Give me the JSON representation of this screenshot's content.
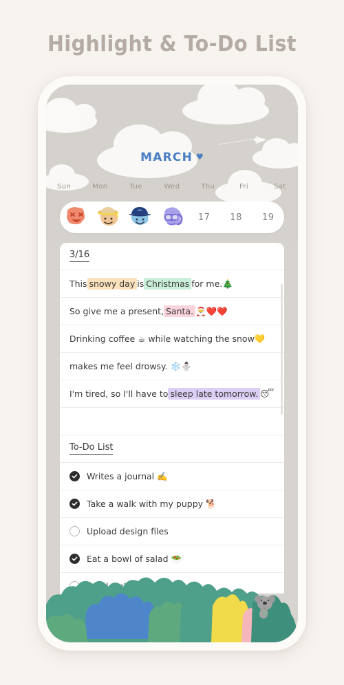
{
  "page": {
    "title": "Highlight & To-Do List",
    "background_color": "#F7F3EF",
    "title_color": "#B4ACA4"
  },
  "calendar": {
    "month_label": "MARCH",
    "month_heart": "♥",
    "month_color": "#4B7FC4",
    "days_of_week": [
      "Sun",
      "Mon",
      "Tue",
      "Wed",
      "Thu",
      "Fri",
      "Sat"
    ],
    "cells": [
      {
        "type": "sticker",
        "icon": "sticker-face-grin-icon",
        "color": "#F08A6E"
      },
      {
        "type": "sticker",
        "icon": "sticker-face-straw-hat-icon",
        "color": "#EFC595"
      },
      {
        "type": "sticker",
        "icon": "sticker-face-blue-cap-icon",
        "color": "#8FC5E6"
      },
      {
        "type": "sticker",
        "icon": "sticker-face-snorkel-icon",
        "color": "#A8A0E8"
      },
      {
        "type": "date",
        "label": "17"
      },
      {
        "type": "date",
        "label": "18"
      },
      {
        "type": "date",
        "label": "19"
      }
    ]
  },
  "journal": {
    "date_header": "3/16",
    "lines": [
      {
        "parts": [
          {
            "text": "This ",
            "highlight": "none"
          },
          {
            "text": "snowy day",
            "highlight": "orange"
          },
          {
            "text": " is ",
            "highlight": "none"
          },
          {
            "text": "Christmas",
            "highlight": "green"
          },
          {
            "text": " for me. ",
            "highlight": "none"
          },
          {
            "text": "🎄",
            "highlight": "none"
          }
        ]
      },
      {
        "parts": [
          {
            "text": "So give me a present, ",
            "highlight": "none"
          },
          {
            "text": "Santa.",
            "highlight": "pink"
          },
          {
            "text": " 🎅❤️❤️",
            "highlight": "none"
          }
        ]
      },
      {
        "parts": [
          {
            "text": "Drinking coffee ☕ while watching the snow",
            "highlight": "none"
          },
          {
            "text": "💛",
            "highlight": "none"
          }
        ]
      },
      {
        "parts": [
          {
            "text": "makes me feel drowsy. ❄️⛄",
            "highlight": "none"
          }
        ]
      },
      {
        "parts": [
          {
            "text": "I'm tired, so I'll have to ",
            "highlight": "none"
          },
          {
            "text": "sleep late tomorrow.",
            "highlight": "purple"
          },
          {
            "text": " 😴",
            "highlight": "none"
          }
        ]
      }
    ],
    "highlight_colors": {
      "orange": "#FBE2BC",
      "green": "#C9EEDA",
      "pink": "#F9D4DD",
      "purple": "#DCCFF5"
    }
  },
  "todo": {
    "header": "To-Do List",
    "items": [
      {
        "label": "Writes a journal ✍️",
        "checked": true
      },
      {
        "label": "Take a walk with my puppy 🐕",
        "checked": true
      },
      {
        "label": "Upload design files",
        "checked": false
      },
      {
        "label": "Eat a bowl of salad 🥗",
        "checked": true
      },
      {
        "label": "Read a chapter 📚",
        "checked": false
      }
    ],
    "checked_color": "#2E2E2E",
    "unchecked_border_color": "#B9B6B1"
  },
  "decoration": {
    "bush_colors": [
      "#4FA08A",
      "#5FA97F",
      "#4E86C9",
      "#F2DB4A",
      "#F5B7BC",
      "#3E8F7C"
    ],
    "koala": "koala-icon",
    "plane": "airplane-icon",
    "clouds": "cloud-icon"
  }
}
